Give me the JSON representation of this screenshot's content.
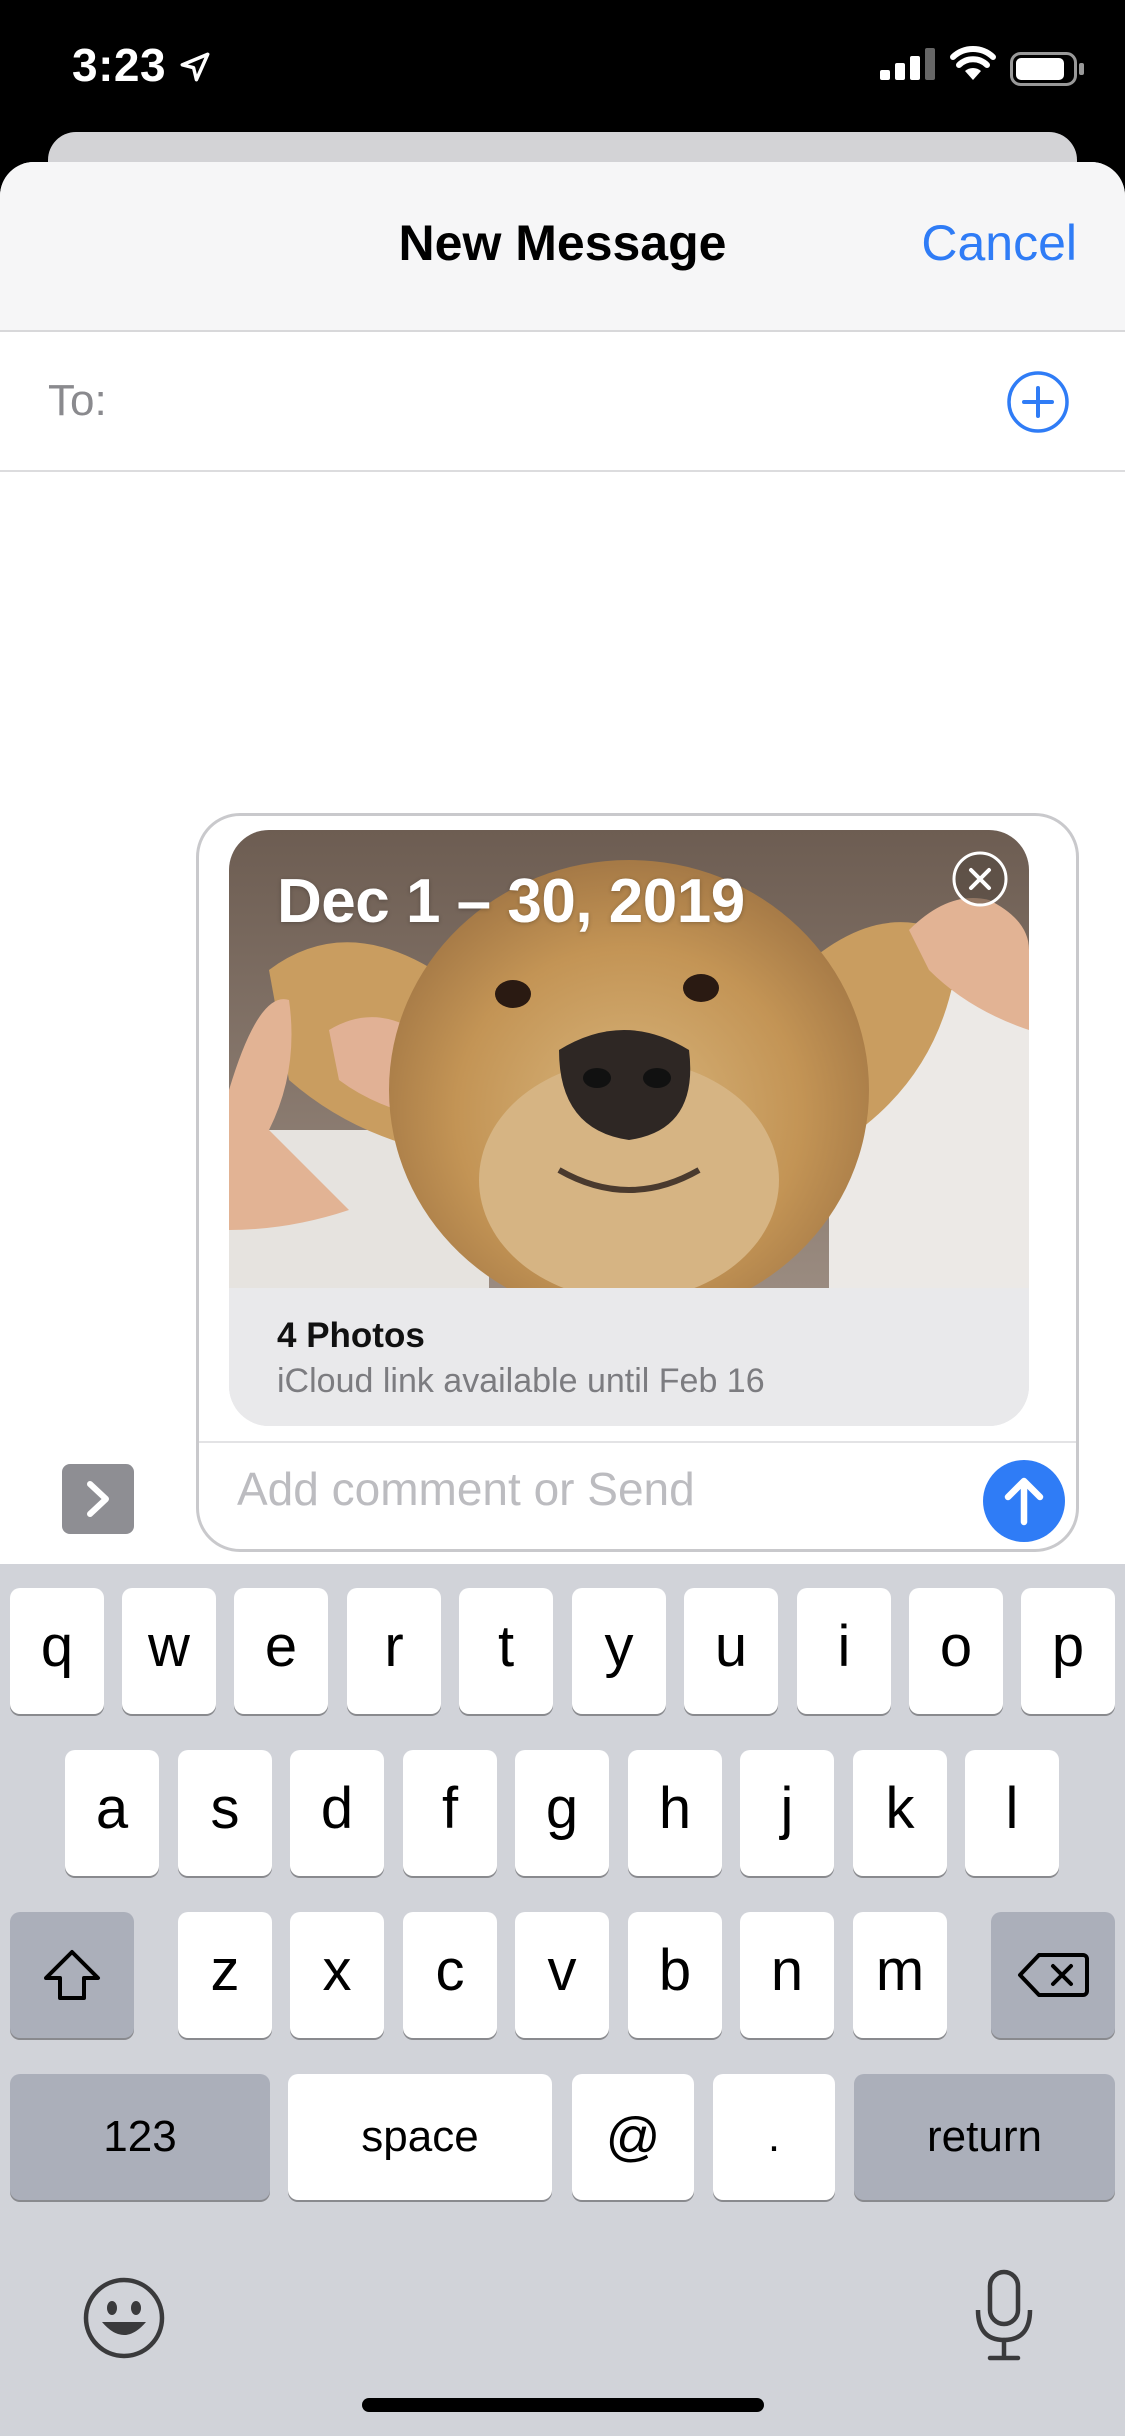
{
  "status_bar": {
    "time": "3:23"
  },
  "header": {
    "title": "New Message",
    "cancel_label": "Cancel"
  },
  "recipients": {
    "to_label": "To:"
  },
  "attachment": {
    "date_range": "Dec 1 – 30, 2019",
    "photo_count": "4 Photos",
    "link_note": "iCloud link available until Feb 16"
  },
  "composer": {
    "placeholder": "Add comment or Send"
  },
  "keyboard": {
    "row1": [
      "q",
      "w",
      "e",
      "r",
      "t",
      "y",
      "u",
      "i",
      "o",
      "p"
    ],
    "row2": [
      "a",
      "s",
      "d",
      "f",
      "g",
      "h",
      "j",
      "k",
      "l"
    ],
    "row3": [
      "z",
      "x",
      "c",
      "v",
      "b",
      "n",
      "m"
    ],
    "numbers_label": "123",
    "space_label": "space",
    "at_label": "@",
    "dot_label": ".",
    "return_label": "return"
  },
  "colors": {
    "accent": "#2f7cf6",
    "keyboard_bg": "#d1d3d9",
    "send": "#2f7cf6"
  },
  "icons": [
    "location-arrow-icon",
    "cellular-signal-icon",
    "wifi-icon",
    "battery-icon",
    "add-contact-icon",
    "close-icon",
    "send-arrow-icon",
    "chevron-right-icon",
    "shift-icon",
    "backspace-icon",
    "emoji-icon",
    "microphone-icon"
  ]
}
